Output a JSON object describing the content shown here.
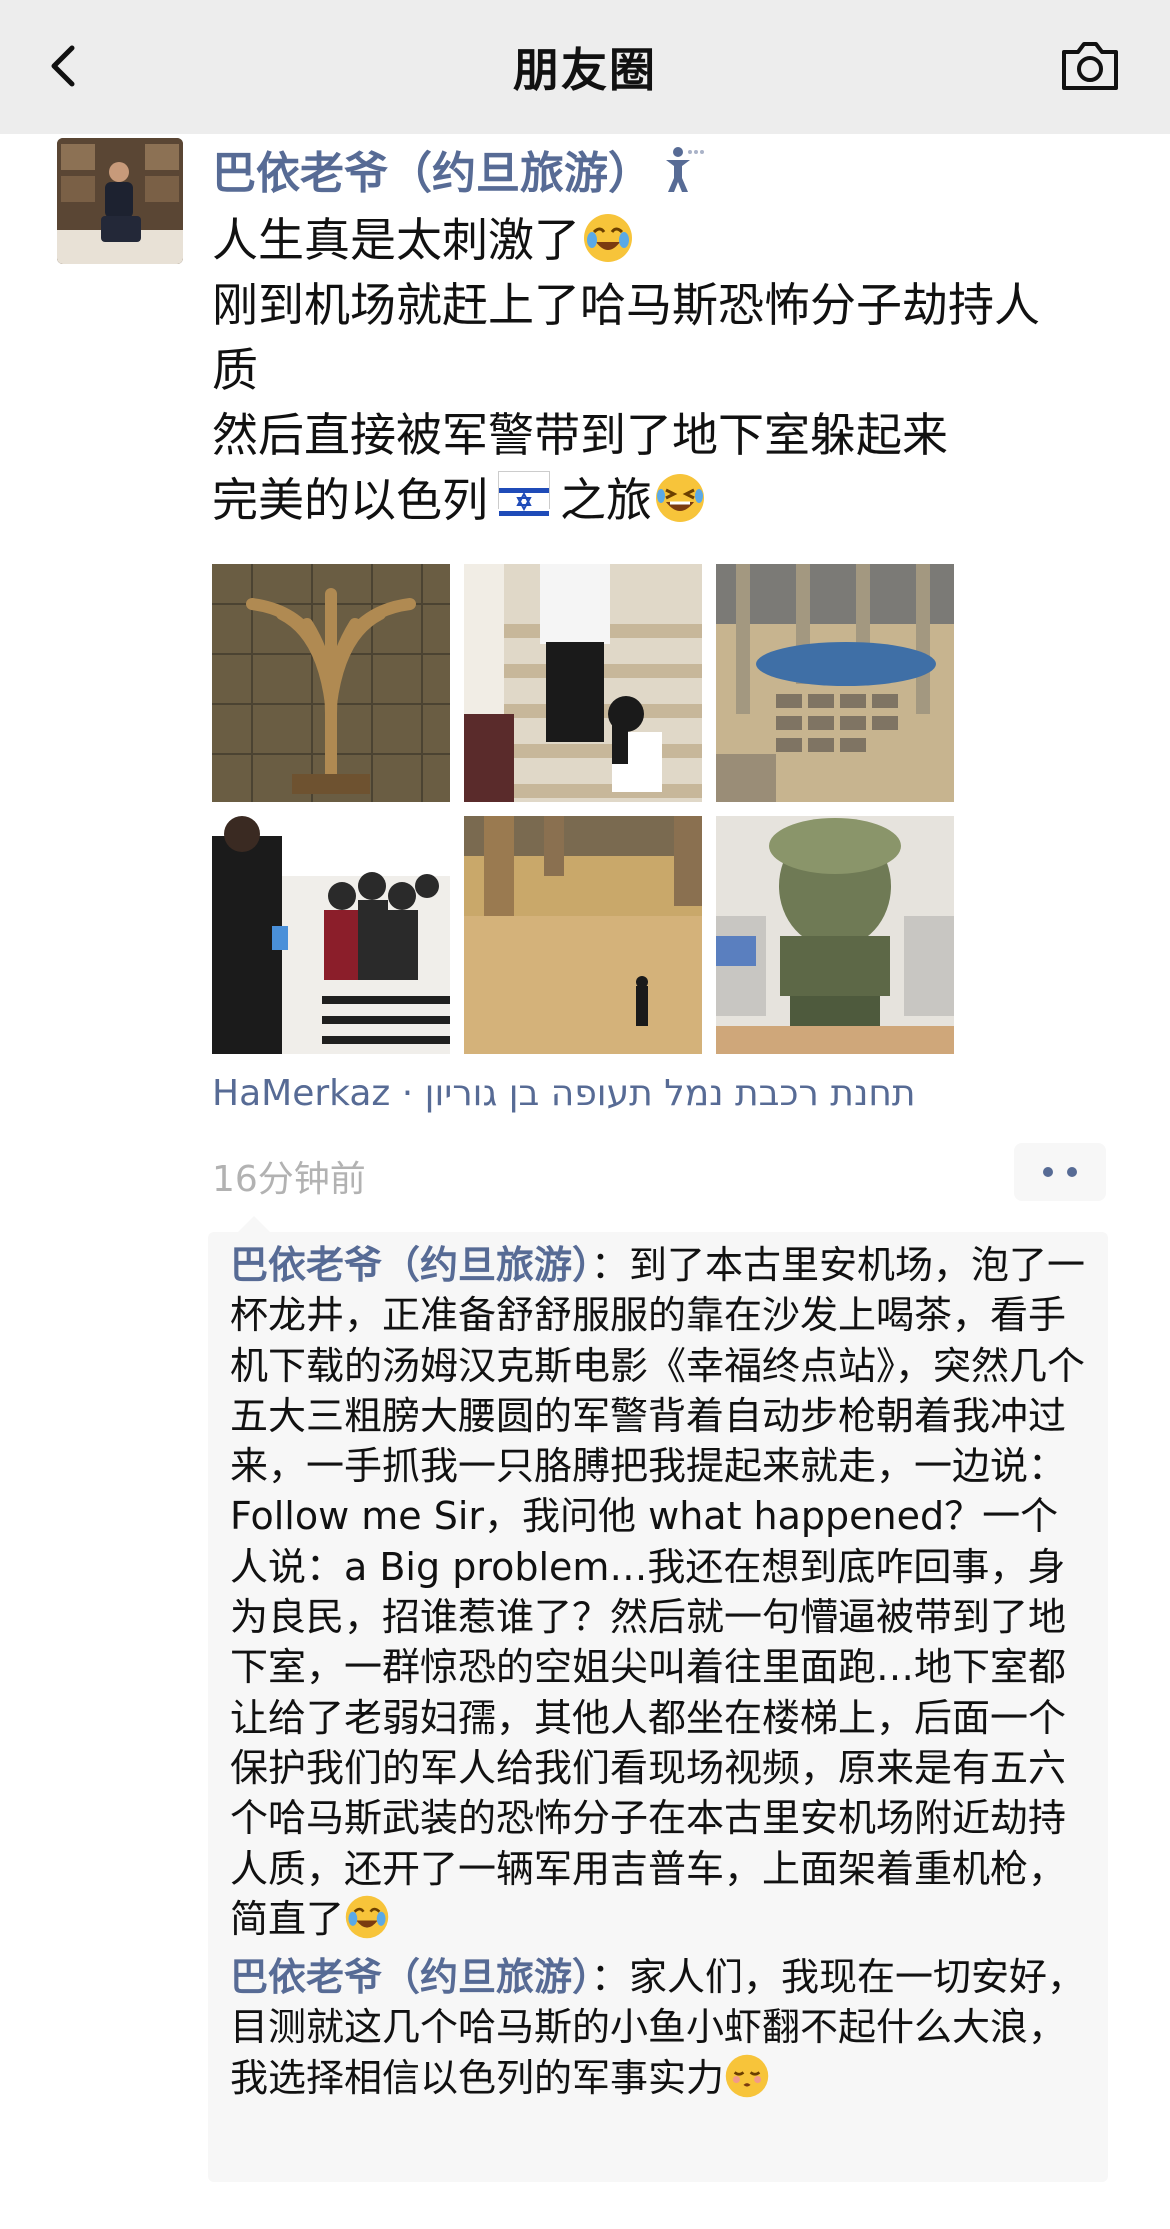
{
  "nav": {
    "title": "朋友圈",
    "back_icon": "chevron-left-icon",
    "camera_icon": "camera-icon"
  },
  "post": {
    "author": "巴依老爷（约旦旅游）",
    "author_icon": "person-status-icon",
    "text_lines": [
      "人生真是太刺激了",
      "刚到机场就赶上了哈马斯恐怖分子劫持人",
      "质",
      "然后直接被军警带到了地下室躲起来",
      "完美的以色列",
      "之旅"
    ],
    "emojis": [
      "crying-laughing-emoji",
      "israel-flag-emoji",
      "grinning-tears-emoji"
    ],
    "photos": [
      {
        "name": "menorah-sculpture-photo",
        "color": "#8a6a3e"
      },
      {
        "name": "stairs-people-photo",
        "color": "#cfc4b0"
      },
      {
        "name": "airport-hall-photo",
        "color": "#b9a88d"
      },
      {
        "name": "stairwell-crowd-photo",
        "color": "#d8d4cf"
      },
      {
        "name": "empty-hall-floor-photo",
        "color": "#c9a86a"
      },
      {
        "name": "bronze-bust-photo",
        "color": "#6f7a55"
      }
    ],
    "location": "HaMerkaz · תחנת רכבת נמל תעופה בן גוריון",
    "time": "16分钟前"
  },
  "comments": [
    {
      "author": "巴依老爷（约旦旅游）",
      "text": "：到了本古里安机场，泡了一杯龙井，正准备舒舒服服的靠在沙发上喝茶，看手机下载的汤姆汉克斯电影《幸福终点站》，突然几个五大三粗膀大腰圆的军警背着自动步枪朝着我冲过来，一手抓我一只胳膊把我提起来就走，一边说：Follow me Sir，我问他 what happened？一个人说：a Big problem…我还在想到底咋回事，身为良民，招谁惹谁了？然后就一句懵逼被带到了地下室，一群惊恐的空姐尖叫着往里面跑…地下室都让给了老弱妇孺，其他人都坐在楼梯上，后面一个保护我们的军人给我们看现场视频，原来是有五六个哈马斯武装的恐怖分子在本古里安机场附近劫持人质，还开了一辆军用吉普车，上面架着重机枪，简直了",
      "emoji": "crying-laughing-emoji"
    },
    {
      "author": "巴依老爷（约旦旅游）",
      "text": "：家人们，我现在一切安好，目测就这几个哈马斯的小鱼小虾翻不起什么大浪，我选择相信以色列的军事实力",
      "emoji": "relieved-kiss-emoji"
    }
  ],
  "colors": {
    "link_blue": "#576b95",
    "nav_bg": "#ededed",
    "comment_bg": "#f7f7f7",
    "time_gray": "#b2b2b2"
  }
}
